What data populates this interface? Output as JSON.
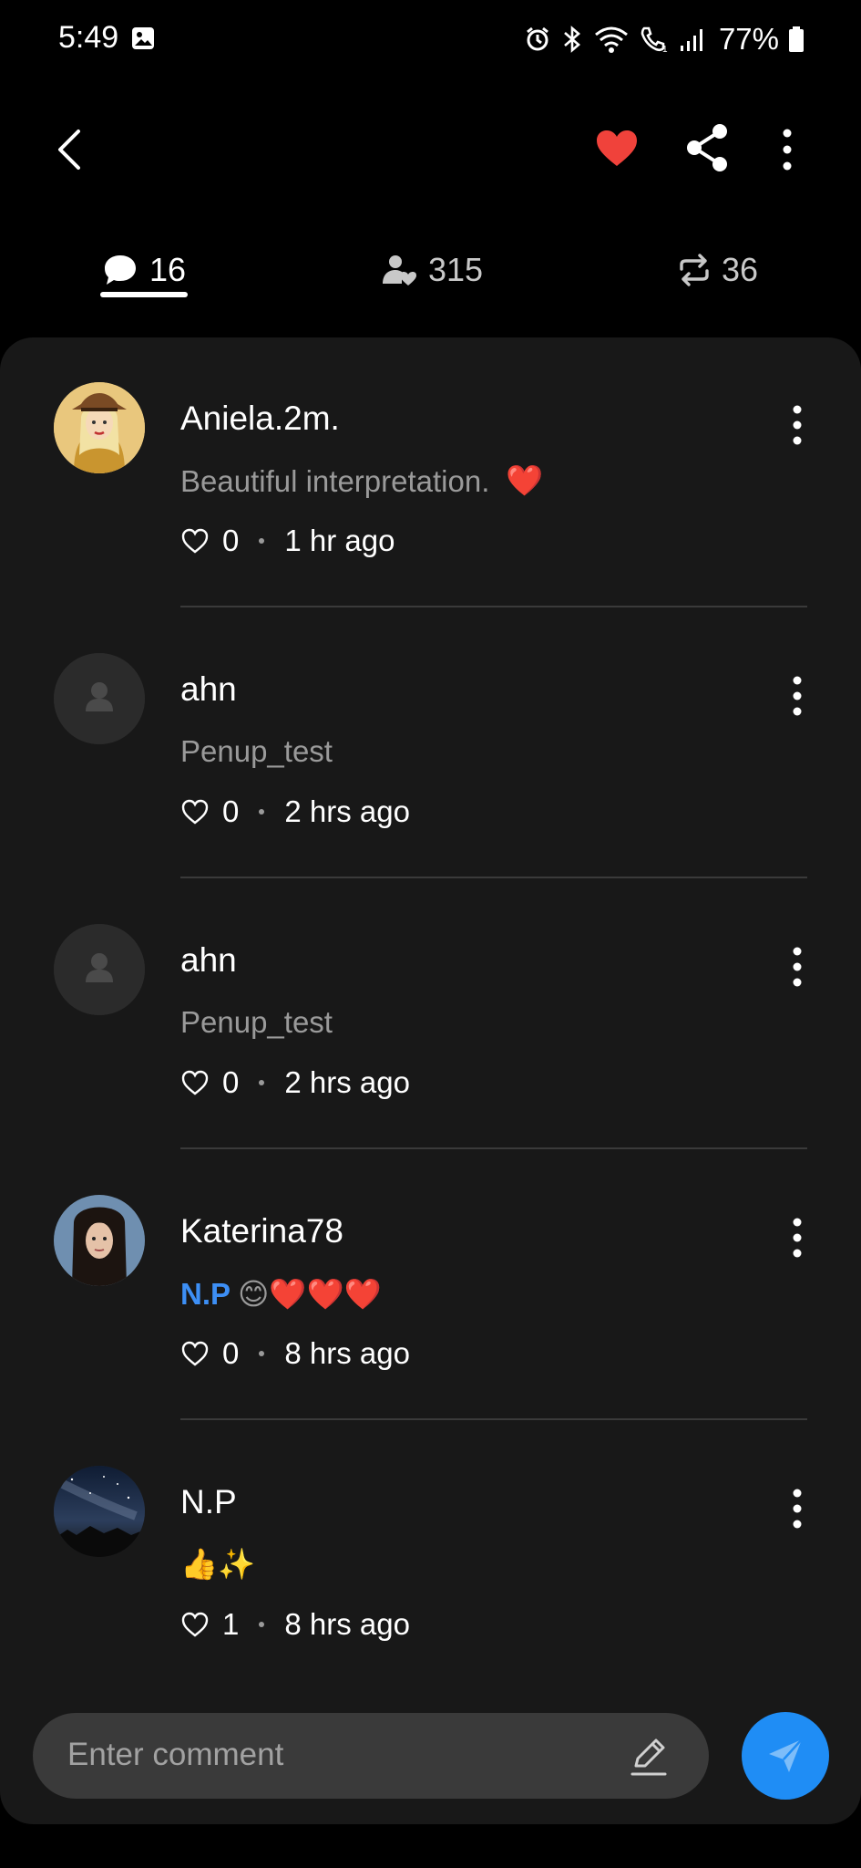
{
  "status_bar": {
    "time": "5:49",
    "battery": "77%",
    "icons": [
      "gallery-icon",
      "alarm-icon",
      "bluetooth-icon",
      "wifi-icon",
      "call-icon",
      "signal-icon",
      "battery-icon"
    ]
  },
  "app_bar": {
    "icons": [
      "back-icon",
      "heart-icon",
      "share-icon",
      "more-vert-icon"
    ],
    "heart_color": "#f0423b"
  },
  "tabs": [
    {
      "name": "comments",
      "icon": "comment-bubble-icon",
      "count": "16",
      "selected": true
    },
    {
      "name": "likes",
      "icon": "user-heart-icon",
      "count": "315",
      "selected": false
    },
    {
      "name": "reposts",
      "icon": "repost-icon",
      "count": "36",
      "selected": false
    }
  ],
  "comments": [
    {
      "author": "Aniela.2m.",
      "text": "Beautiful interpretation.",
      "emoji": "❤️",
      "likes": "0",
      "time": "1 hr ago",
      "avatar": "photo"
    },
    {
      "author": "ahn",
      "text": "Penup_test",
      "likes": "0",
      "time": "2 hrs ago",
      "avatar": "default"
    },
    {
      "author": "ahn",
      "text": "Penup_test",
      "likes": "0",
      "time": "2 hrs ago",
      "avatar": "default"
    },
    {
      "author": "Katerina78",
      "mention": "N.P",
      "emoji": "😊❤️❤️❤️",
      "likes": "0",
      "time": "8 hrs ago",
      "avatar": "photo"
    },
    {
      "author": "N.P",
      "emoji": "👍✨",
      "likes": "1",
      "time": "8 hrs ago",
      "avatar": "photo"
    }
  ],
  "input": {
    "placeholder": "Enter comment",
    "send_color": "#1f8df5"
  }
}
